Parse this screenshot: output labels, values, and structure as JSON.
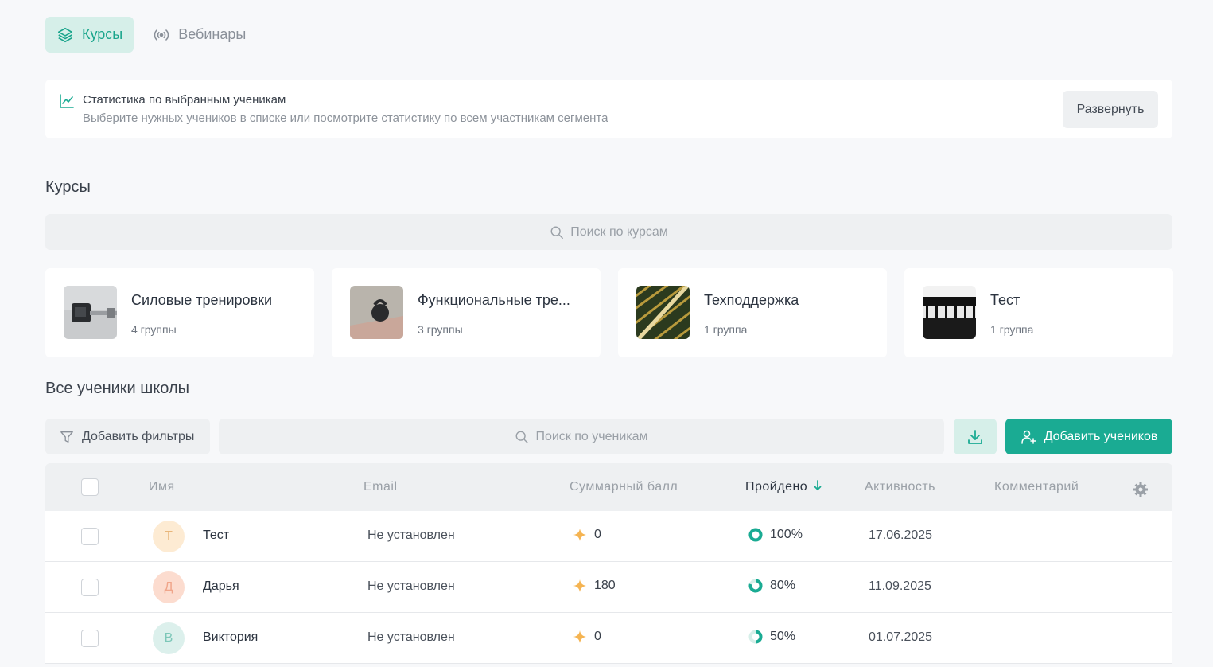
{
  "tabs": [
    {
      "label": "Курсы",
      "icon": "layers-icon",
      "active": true
    },
    {
      "label": "Вебинары",
      "icon": "broadcast-icon",
      "active": false
    }
  ],
  "stats": {
    "title": "Статистика по выбранным ученикам",
    "subtitle": "Выберите нужных учеников в списке или посмотрите статистику по всем участникам сегмента",
    "expand_label": "Развернуть"
  },
  "courses_section": {
    "title": "Курсы",
    "search_placeholder": "Поиск по курсам",
    "items": [
      {
        "name": "Силовые тренировки",
        "groups": "4 группы"
      },
      {
        "name": "Функциональные тре...",
        "groups": "3 группы"
      },
      {
        "name": "Техподдержка",
        "groups": "1 группа"
      },
      {
        "name": "Тест",
        "groups": "1 группа"
      }
    ]
  },
  "students_section": {
    "title": "Все ученики школы",
    "filter_label": "Добавить фильтры",
    "search_placeholder": "Поиск по ученикам",
    "add_label": "Добавить учеников",
    "columns": {
      "name": "Имя",
      "email": "Email",
      "score": "Суммарный балл",
      "passed": "Пройдено",
      "activity": "Активность",
      "comment": "Комментарий"
    },
    "rows": [
      {
        "initial": "Т",
        "name": "Тест",
        "email": "Не установлен",
        "score": "0",
        "passed": "100%",
        "passed_fraction": 1.0,
        "activity": "17.06.2025",
        "avatar_bg": "#fdebd3",
        "avatar_fg": "#e8b67a"
      },
      {
        "initial": "Д",
        "name": "Дарья",
        "email": "Не установлен",
        "score": "180",
        "passed": "80%",
        "passed_fraction": 0.8,
        "activity": "11.09.2025",
        "avatar_bg": "#fcdccf",
        "avatar_fg": "#f0a58a"
      },
      {
        "initial": "В",
        "name": "Виктория",
        "email": "Не установлен",
        "score": "0",
        "passed": "50%",
        "passed_fraction": 0.5,
        "activity": "01.07.2025",
        "avatar_bg": "#dcf0ec",
        "avatar_fg": "#7cc7b8"
      }
    ]
  },
  "colors": {
    "accent": "#1aab93",
    "accent_light": "#d6efe9",
    "star": "#f5b452"
  }
}
